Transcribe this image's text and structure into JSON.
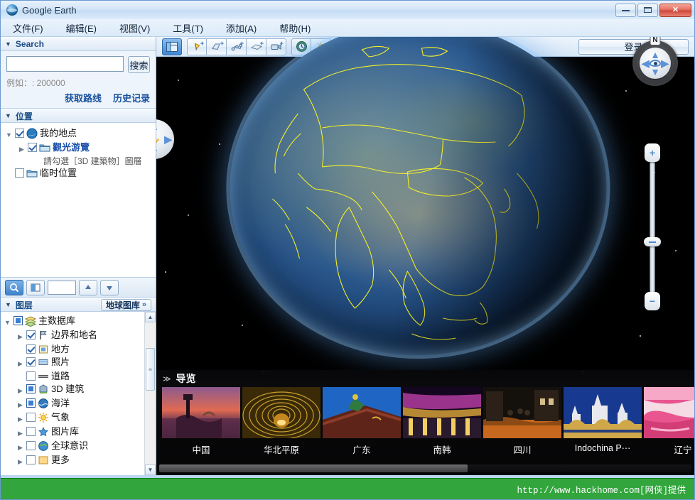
{
  "window": {
    "title": "Google Earth",
    "minimize_label": "minimize",
    "maximize_label": "maximize",
    "close_label": "✕"
  },
  "menu": [
    {
      "label": "文件(F)"
    },
    {
      "label": "编辑(E)"
    },
    {
      "label": "视图(V)"
    },
    {
      "label": "工具(T)"
    },
    {
      "label": "添加(A)"
    },
    {
      "label": "帮助(H)"
    }
  ],
  "toolbar": {
    "buttons": [
      {
        "name": "toggle-sidebar",
        "icon": "sidebar-icon"
      },
      {
        "name": "add-placemark",
        "icon": "placemark-icon"
      },
      {
        "name": "add-polygon",
        "icon": "polygon-icon"
      },
      {
        "name": "add-path",
        "icon": "path-icon"
      },
      {
        "name": "add-image-overlay",
        "icon": "overlay-icon"
      },
      {
        "name": "record-tour",
        "icon": "camera-icon"
      },
      {
        "name": "historical-imagery",
        "icon": "clock-icon"
      },
      {
        "name": "sunlight",
        "icon": "sun-icon"
      },
      {
        "name": "planets",
        "icon": "planet-icon"
      },
      {
        "name": "ruler",
        "icon": "ruler-icon"
      },
      {
        "name": "email",
        "icon": "envelope-icon"
      },
      {
        "name": "print",
        "icon": "printer-icon"
      },
      {
        "name": "view-in-maps",
        "icon": "globe-maps-icon"
      },
      {
        "name": "save-image",
        "icon": "save-image-icon"
      }
    ],
    "login_label": "登录"
  },
  "search": {
    "panel_title": "Search",
    "input_value": "",
    "input_placeholder": "",
    "button_label": "搜索",
    "hint": "例如：: 200000",
    "links": [
      {
        "label": "获取路线"
      },
      {
        "label": "历史记录"
      }
    ]
  },
  "places": {
    "panel_title": "位置",
    "items": [
      {
        "label": "我的地点",
        "icon": "earth-icon",
        "checked": true,
        "level": 1,
        "expander": "▼"
      },
      {
        "label": "觀光游覽",
        "icon": "folder-icon",
        "checked": true,
        "level": 2,
        "expander": "▶",
        "link": true
      },
      {
        "label": "臨時位置",
        "icon": "folder-icon",
        "checked": false,
        "level": 1,
        "expander": ""
      }
    ],
    "note": "請勾選［3D 建築物］圖層",
    "temp_label": "临时位置"
  },
  "places_toolbar": {
    "search_icon": "magnifier-icon",
    "opacity_icon": "opacity-slider-icon",
    "field_value": "",
    "up_label": "▲",
    "down_label": "▼"
  },
  "layers": {
    "panel_title": "图层",
    "gallery_button": "地球图库",
    "gallery_chevron": "»",
    "items": [
      {
        "label": "主数据库",
        "icon": "layers-stack-icon",
        "state": "filled",
        "expander": "▼"
      },
      {
        "label": "边界和地名",
        "icon": "boundary-icon",
        "state": "checked",
        "expander": "▶"
      },
      {
        "label": "地方",
        "icon": "place-icon",
        "state": "checked",
        "expander": ""
      },
      {
        "label": "照片",
        "icon": "photo-icon",
        "state": "checked",
        "expander": "▶"
      },
      {
        "label": "道路",
        "icon": "road-icon",
        "state": "off",
        "expander": ""
      },
      {
        "label": "3D 建筑",
        "icon": "building-icon",
        "state": "filled",
        "expander": "▶"
      },
      {
        "label": "海洋",
        "icon": "ocean-icon",
        "state": "filled",
        "expander": "▶"
      },
      {
        "label": "气象",
        "icon": "weather-icon",
        "state": "off",
        "expander": "▶"
      },
      {
        "label": "图片库",
        "icon": "gallery-star-icon",
        "state": "off",
        "expander": "▶"
      },
      {
        "label": "全球意识",
        "icon": "globe-awareness-icon",
        "state": "off",
        "expander": "▶"
      },
      {
        "label": "更多",
        "icon": "more-icon",
        "state": "off",
        "expander": "▶"
      }
    ]
  },
  "navigation": {
    "north_label": "N",
    "look_icon": "eye-icon",
    "pan_icon": "hand-icon",
    "zoom_in_label": "+",
    "zoom_out_label": "−",
    "arrows": {
      "up": "▲",
      "down": "▼",
      "left": "◀",
      "right": "▶"
    }
  },
  "tour": {
    "title": "导览",
    "chevron": "≫",
    "items": [
      {
        "caption": "中国",
        "theme": "sunset-lake"
      },
      {
        "caption": "华北平原",
        "theme": "golden-dome"
      },
      {
        "caption": "广东",
        "theme": "temple-roof"
      },
      {
        "caption": "南韩",
        "theme": "neon-bridge"
      },
      {
        "caption": "四川",
        "theme": "night-street"
      },
      {
        "caption": "Indochina P⋯",
        "theme": "white-pagoda"
      },
      {
        "caption": "辽宁",
        "theme": "pink-marsh"
      }
    ]
  },
  "statusbar": {
    "text": "http://www.hackhome.com[网侠]提供"
  }
}
